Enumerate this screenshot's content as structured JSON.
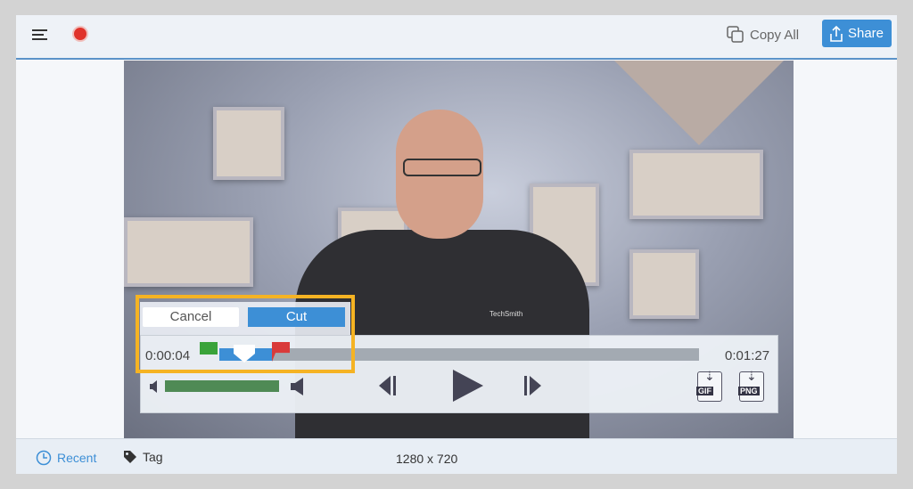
{
  "toolbar": {
    "menu_icon": "hamburger-icon",
    "record_icon": "record-dot",
    "copy_all": "Copy All",
    "share": "Share"
  },
  "colors": {
    "accent": "#3d8fd6",
    "record": "#e0332b",
    "highlight": "#f5b323",
    "volume": "#4f8a55",
    "start_marker": "#3aa33a",
    "end_marker": "#d93a3a"
  },
  "editor": {
    "cancel": "Cancel",
    "cut": "Cut",
    "current_time": "0:00:04",
    "total_time": "0:01:27",
    "gif": "GIF",
    "png": "PNG"
  },
  "video": {
    "shirt_logo": "TechSmith"
  },
  "status": {
    "recent": "Recent",
    "tag": "Tag",
    "dimensions": "1280 x 720"
  }
}
